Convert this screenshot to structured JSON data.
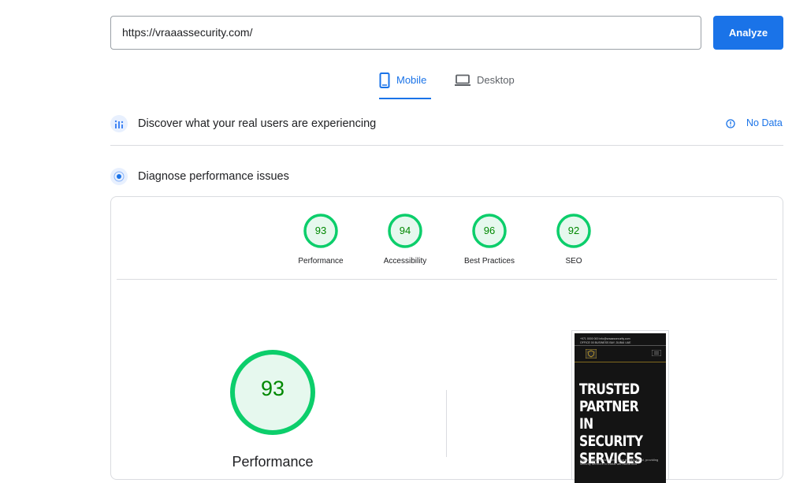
{
  "search": {
    "url_value": "https://vraaassecurity.com/",
    "analyze_label": "Analyze"
  },
  "tabs": [
    {
      "label": "Mobile",
      "icon": "phone-icon",
      "active": true
    },
    {
      "label": "Desktop",
      "icon": "laptop-icon",
      "active": false
    }
  ],
  "field_data": {
    "title": "Discover what your real users are experiencing",
    "status": "No Data"
  },
  "lab_data": {
    "title": "Diagnose performance issues",
    "scores": [
      {
        "label": "Performance",
        "value": "93"
      },
      {
        "label": "Accessibility",
        "value": "94"
      },
      {
        "label": "Best Practices",
        "value": "96"
      },
      {
        "label": "SEO",
        "value": "92"
      }
    ],
    "main_score": {
      "label": "Performance",
      "value": "93"
    }
  },
  "screenshot": {
    "header_text": "+971 0000 000  info@vraaassecurity.com\nOFFICE 00 BUSINESS BAY, DUBAI UAE",
    "headline": "TRUSTED\nPARTNER IN\nSECURITY\nSERVICES",
    "subtext": "Vraaas Security Services - your trusted shield, providing security services in Dubai with advanced"
  },
  "colors": {
    "accent": "#1a73e8",
    "score_green": "#0cce6b",
    "score_text": "#008800",
    "score_fill": "#e6f8ee"
  }
}
